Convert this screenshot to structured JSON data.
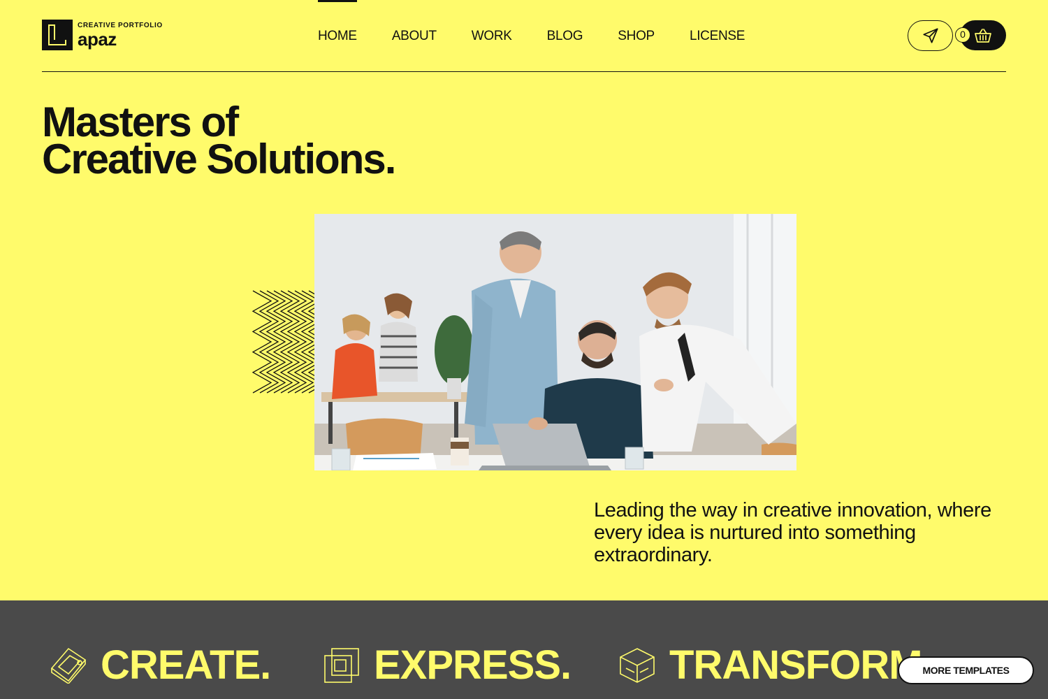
{
  "colors": {
    "accent": "#fffb6b",
    "dark": "#111111",
    "band": "#4a4a4a"
  },
  "logo": {
    "sub": "CREATIVE PORTFOLIO",
    "name": "apaz"
  },
  "nav": {
    "items": [
      "HOME",
      "ABOUT",
      "WORK",
      "BLOG",
      "SHOP",
      "LICENSE"
    ],
    "active": "HOME"
  },
  "header": {
    "send_icon": "paper-plane-icon",
    "cart_icon": "basket-icon",
    "cart_count": "0"
  },
  "hero": {
    "title_line1": "Masters of",
    "title_line2": "Creative Solutions.",
    "description": "Leading the way in creative innovation, where every idea is nurtured into something extraordinary."
  },
  "band": {
    "words": [
      {
        "text": "CREATE.",
        "icon": "isometric-tile-icon"
      },
      {
        "text": "EXPRESS.",
        "icon": "stacked-squares-icon"
      },
      {
        "text": "TRANSFORM",
        "icon": "cube-icon"
      }
    ]
  },
  "more_templates": "MORE TEMPLATES"
}
